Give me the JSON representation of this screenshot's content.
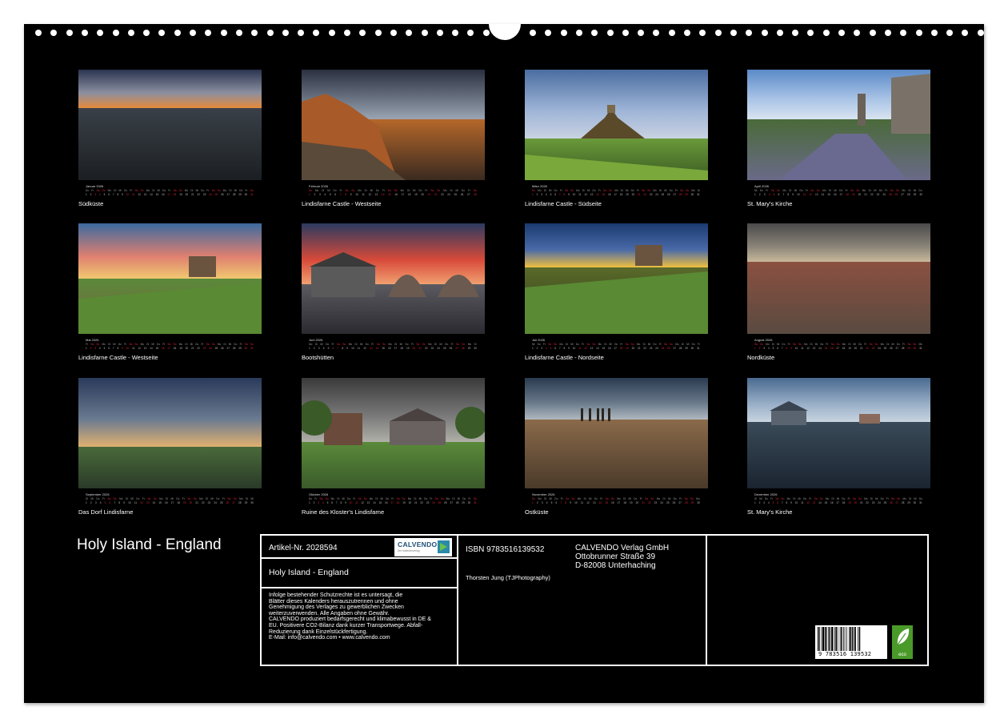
{
  "months": [
    {
      "label": "Januar 2026",
      "caption": "Südküste",
      "days": 31,
      "start": 3
    },
    {
      "label": "Februar 2026",
      "caption": "Lindisfarne Castle - Westseite",
      "days": 28,
      "start": 6
    },
    {
      "label": "März 2026",
      "caption": "Lindisfarne Castle - Südseite",
      "days": 31,
      "start": 6
    },
    {
      "label": "April 2026",
      "caption": "St. Mary's Kirche",
      "days": 30,
      "start": 2
    },
    {
      "label": "Mai 2026",
      "caption": "Lindisfarne Castle - Westseite",
      "days": 31,
      "start": 4
    },
    {
      "label": "Juni 2026",
      "caption": "Bootshütten",
      "days": 30,
      "start": 0
    },
    {
      "label": "Juli 2026",
      "caption": "Lindisfarne Castle - Nordseite",
      "days": 31,
      "start": 2
    },
    {
      "label": "August 2026",
      "caption": "Nordküste",
      "days": 31,
      "start": 5
    },
    {
      "label": "September 2026",
      "caption": "Das Dorf Lindisfarne",
      "days": 30,
      "start": 1
    },
    {
      "label": "Oktober 2026",
      "caption": "Ruine des Kloster's Lindisfarne",
      "days": 31,
      "start": 3
    },
    {
      "label": "November 2026",
      "caption": "Ostküste",
      "days": 30,
      "start": 6
    },
    {
      "label": "Dezember 2026",
      "caption": "St. Mary's Kirche",
      "days": 31,
      "start": 1
    }
  ],
  "weekday_abbr": [
    "Mo",
    "Di",
    "Mi",
    "Do",
    "Fr",
    "Sa",
    "So"
  ],
  "calendar_title": "Holy Island - England",
  "info": {
    "article": "Artikel-Nr. 2028594",
    "logo_brand": "CALVENDO",
    "logo_tagline": "Der Kalenderverlag",
    "subtitle": "Holy Island - England",
    "isbn": "ISBN 9783516139532",
    "author": "Thorsten Jung (TJPhotography)",
    "publisher_lines": [
      "CALVENDO Verlag GmbH",
      "Ottobrunner Straße 39",
      "D-82008 Unterhaching"
    ],
    "legal_lines": [
      "Infolge bestehender Schutzrechte ist es untersagt, die",
      "Blätter dieses Kalenders herauszutrennen und ohne",
      "Genehmigung des Verlages zu gewerblichen Zwecken",
      "weiterzuverwenden. Alle Angaben ohne Gewähr.",
      "CALVENDO produziert bedarfsgerecht und klimabewusst in DE &",
      "EU. Positivere CO2-Bilanz dank kurzer Transportwege. Abfall-",
      "Reduzierung dank Einzelstückfertigung.",
      "E-Mail: info@calvendo.com • www.calvendo.com"
    ],
    "barcode_number": "9 783516 139532",
    "eco_label": "eco"
  },
  "colors": {
    "sheet": "#000000",
    "weekend": "#dd2233",
    "eco": "#4a9a2a",
    "logo_blue": "#1f4f78"
  }
}
